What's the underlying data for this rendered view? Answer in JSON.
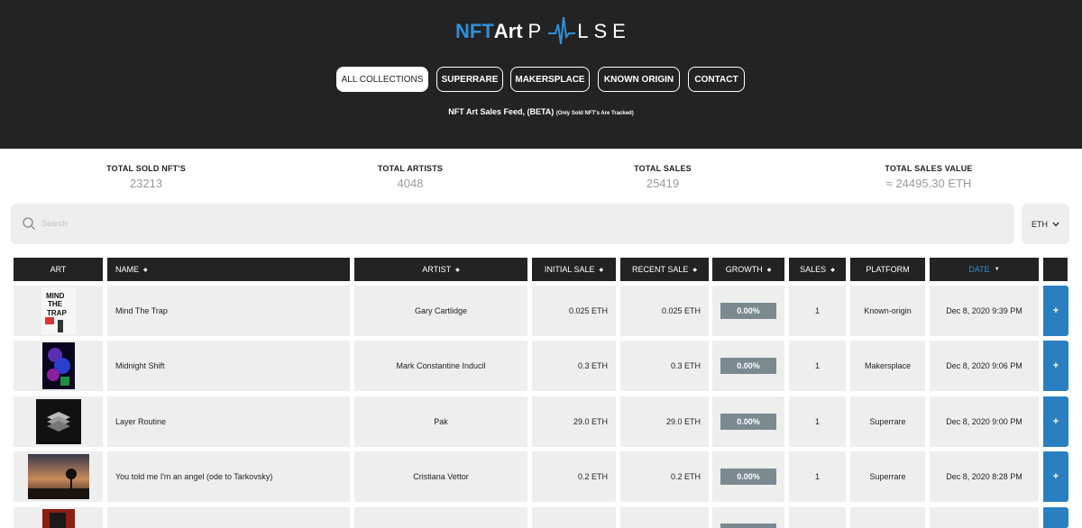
{
  "header": {
    "logo_nft": "NFT",
    "logo_art": "Art",
    "logo_pulse": "LSE",
    "logo_pulse_prefix": "P",
    "nav": [
      {
        "label": "ALL COLLECTIONS",
        "active": true
      },
      {
        "label": "SUPERRARE",
        "active": false
      },
      {
        "label": "MAKERSPLACE",
        "active": false
      },
      {
        "label": "KNOWN ORIGIN",
        "active": false
      },
      {
        "label": "CONTACT",
        "active": false
      }
    ],
    "subtitle_main": "NFT Art Sales Feed, (BETA)",
    "subtitle_small": "(Only Sold NFT's Are Tracked)"
  },
  "stats": [
    {
      "label": "TOTAL SOLD NFT'S",
      "value": "23213"
    },
    {
      "label": "TOTAL ARTISTS",
      "value": "4048"
    },
    {
      "label": "TOTAL SALES",
      "value": "25419"
    },
    {
      "label": "TOTAL SALES VALUE",
      "value": "≈ 24495.30 ETH"
    }
  ],
  "search": {
    "placeholder": "Search"
  },
  "currency": {
    "selected": "ETH"
  },
  "table": {
    "headers": {
      "art": "ART",
      "name": "NAME",
      "artist": "ARTIST",
      "initial_sale": "INITIAL SALE",
      "recent_sale": "RECENT SALE",
      "growth": "GROWTH",
      "sales": "SALES",
      "platform": "PLATFORM",
      "date": "DATE"
    },
    "rows": [
      {
        "name": "Mind The Trap",
        "artist": "Gary Cartlidge",
        "initial_sale": "0.025 ETH",
        "recent_sale": "0.025 ETH",
        "growth": "0.00%",
        "sales": "1",
        "platform": "Known-origin",
        "date": "Dec 8, 2020 9:39 PM",
        "plus": "+"
      },
      {
        "name": "Midnight Shift",
        "artist": "Mark Constantine Inducil",
        "initial_sale": "0.3 ETH",
        "recent_sale": "0.3 ETH",
        "growth": "0.00%",
        "sales": "1",
        "platform": "Makersplace",
        "date": "Dec 8, 2020 9:06 PM",
        "plus": "+"
      },
      {
        "name": "Layer Routine",
        "artist": "Pak",
        "initial_sale": "29.0 ETH",
        "recent_sale": "29.0 ETH",
        "growth": "0.00%",
        "sales": "1",
        "platform": "Superrare",
        "date": "Dec 8, 2020 9:00 PM",
        "plus": "+"
      },
      {
        "name": "You told me I'm an angel (ode to Tarkovsky)",
        "artist": "Cristiana Vettor",
        "initial_sale": "0.2 ETH",
        "recent_sale": "0.2 ETH",
        "growth": "0.00%",
        "sales": "1",
        "platform": "Superrare",
        "date": "Dec 8, 2020 8:28 PM",
        "plus": "+"
      }
    ]
  },
  "colors": {
    "accent": "#2f8fd8",
    "header_bg": "#232323",
    "plus_button": "#2a7fc1",
    "growth_pill": "#7b8a8f"
  },
  "icons": {
    "search": "search-icon",
    "chevron": "chevron-down-icon",
    "sort": "sort-icon",
    "plus": "plus-icon"
  }
}
